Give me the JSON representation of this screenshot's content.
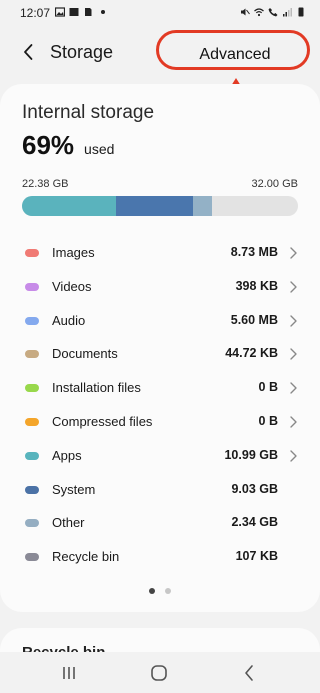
{
  "status_bar": {
    "time": "12:07"
  },
  "header": {
    "title": "Storage",
    "advanced_label": "Advanced"
  },
  "storage": {
    "section_title": "Internal storage",
    "percent_used": "69%",
    "used_suffix": "used",
    "used_amount": "22.38 GB",
    "total_amount": "32.00 GB",
    "bar_segments": [
      {
        "name": "teal",
        "color": "#5ab3bd",
        "fraction": 0.34
      },
      {
        "name": "blue",
        "color": "#4a76ad",
        "fraction": 0.28
      },
      {
        "name": "gray-blue",
        "color": "#93b1c6",
        "fraction": 0.07
      }
    ],
    "categories": [
      {
        "label": "Images",
        "size": "8.73 MB",
        "color": "#f07a74",
        "has_chevron": true
      },
      {
        "label": "Videos",
        "size": "398 KB",
        "color": "#c78be8",
        "has_chevron": true
      },
      {
        "label": "Audio",
        "size": "5.60 MB",
        "color": "#84a9ee",
        "has_chevron": true
      },
      {
        "label": "Documents",
        "size": "44.72 KB",
        "color": "#c7aa82",
        "has_chevron": true
      },
      {
        "label": "Installation files",
        "size": "0 B",
        "color": "#98d84b",
        "has_chevron": true
      },
      {
        "label": "Compressed files",
        "size": "0 B",
        "color": "#f4a52a",
        "has_chevron": true
      },
      {
        "label": "Apps",
        "size": "10.99 GB",
        "color": "#58b4bd",
        "has_chevron": true
      },
      {
        "label": "System",
        "size": "9.03 GB",
        "color": "#4b72a6",
        "has_chevron": false
      },
      {
        "label": "Other",
        "size": "2.34 GB",
        "color": "#95aec2",
        "has_chevron": false
      },
      {
        "label": "Recycle bin",
        "size": "107 KB",
        "color": "#8a8a96",
        "has_chevron": false
      }
    ],
    "pages": 2,
    "active_page": 1
  },
  "next_section": {
    "title": "Recycle bin"
  },
  "nav": {
    "icons": [
      "recent-apps-icon",
      "home-icon",
      "back-icon"
    ]
  },
  "colors": {
    "annotation": "#e23a24"
  }
}
